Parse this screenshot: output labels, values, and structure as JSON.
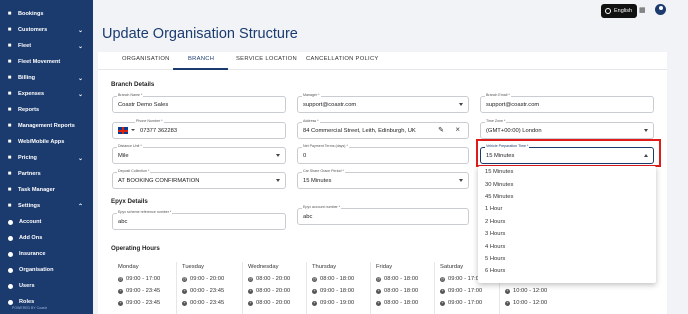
{
  "sidebar": {
    "items": [
      {
        "label": "Bookings",
        "icon": "calendar-icon",
        "chevron": ""
      },
      {
        "label": "Customers",
        "icon": "users-icon",
        "chevron": "⌄"
      },
      {
        "label": "Fleet",
        "icon": "car-icon",
        "chevron": "⌄"
      },
      {
        "label": "Fleet Movement",
        "icon": "truck-icon",
        "chevron": ""
      },
      {
        "label": "Billing",
        "icon": "billing-icon",
        "chevron": "⌄"
      },
      {
        "label": "Expenses",
        "icon": "expenses-icon",
        "chevron": "⌄"
      },
      {
        "label": "Reports",
        "icon": "reports-icon",
        "chevron": ""
      },
      {
        "label": "Management Reports",
        "icon": "chart-icon",
        "chevron": ""
      },
      {
        "label": "Web/Mobile Apps",
        "icon": "globe-icon",
        "chevron": ""
      },
      {
        "label": "Pricing",
        "icon": "tag-icon",
        "chevron": "⌄"
      },
      {
        "label": "Partners",
        "icon": "handshake-icon",
        "chevron": ""
      },
      {
        "label": "Task Manager",
        "icon": "tasks-icon",
        "chevron": ""
      },
      {
        "label": "Settings",
        "icon": "gear-icon",
        "chevron": "⌃"
      }
    ],
    "sub_items": [
      "Account",
      "Add Ons",
      "Insurance",
      "Organisation",
      "Users",
      "Roles"
    ],
    "footer": "POWERED BY Coastr"
  },
  "topbar": {
    "language": "English"
  },
  "page_title": "Update Organisation Structure",
  "tabs": [
    "ORGANISATION",
    "BRANCH",
    "SERVICE LOCATION",
    "CANCELLATION POLICY"
  ],
  "branch_details": {
    "heading": "Branch Details",
    "branch_name": {
      "label": "Branch Name *",
      "value": "Coastr Demo Sales"
    },
    "manager": {
      "label": "Manager *",
      "value": "support@coastr.com"
    },
    "branch_email": {
      "label": "Branch Email *",
      "value": "support@coastr.com"
    },
    "phone": {
      "label": "Phone Number *",
      "value": "07377 362283"
    },
    "address": {
      "label": "Address *",
      "value": "84 Commercial Street, Leith, Edinburgh, UK"
    },
    "time_zone": {
      "label": "Time Zone *",
      "value": "(GMT+00:00) London"
    },
    "distance_unit": {
      "label": "Distance Unit *",
      "value": "Mile"
    },
    "net_payment_terms": {
      "label": "Net Payment Terms (days) *",
      "value": "0"
    },
    "vehicle_prep_time": {
      "label": "Vehicle Preparation Time *",
      "value": "15 Minutes"
    },
    "deposit_collection": {
      "label": "Deposit Collection *",
      "value": "AT BOOKING CONFIRMATION"
    },
    "car_share_grace": {
      "label": "Car Share Grace Period *",
      "value": "15 Minutes"
    }
  },
  "epyx": {
    "heading": "Epyx Details",
    "scheme_ref": {
      "label": "Epyx scheme reference number *",
      "value": "abc"
    },
    "account_number": {
      "label": "Epyx account number *",
      "value": "abc"
    }
  },
  "dropdown_options": [
    "15 Minutes",
    "30 Minutes",
    "45 Minutes",
    "1 Hour",
    "2 Hours",
    "3 Hours",
    "4 Hours",
    "5 Hours",
    "6 Hours"
  ],
  "operating_hours": {
    "heading": "Operating Hours",
    "days": [
      {
        "name": "Monday",
        "slots": [
          "09:00 - 17:00",
          "09:00 - 23:45",
          "09:00 - 23:45"
        ]
      },
      {
        "name": "Tuesday",
        "slots": [
          "09:00 - 20:00",
          "00:00 - 23:45",
          "00:00 - 23:45"
        ]
      },
      {
        "name": "Wednesday",
        "slots": [
          "08:00 - 20:00",
          "08:00 - 20:00",
          "08:00 - 20:00"
        ]
      },
      {
        "name": "Thursday",
        "slots": [
          "08:00 - 18:00",
          "09:00 - 18:00",
          "09:00 - 19:00"
        ]
      },
      {
        "name": "Friday",
        "slots": [
          "08:00 - 18:00",
          "08:00 - 18:00",
          "08:00 - 18:00"
        ]
      },
      {
        "name": "Saturday",
        "slots": [
          "09:00 - 17:00",
          "09:00 - 17:00",
          "09:00 - 17:00"
        ]
      },
      {
        "name": "",
        "slots": [
          "10:00 - 12:00",
          "10:00 - 12:00"
        ]
      }
    ]
  },
  "colors": {
    "primary": "#1b3b6f",
    "highlight": "#e01b1b"
  }
}
